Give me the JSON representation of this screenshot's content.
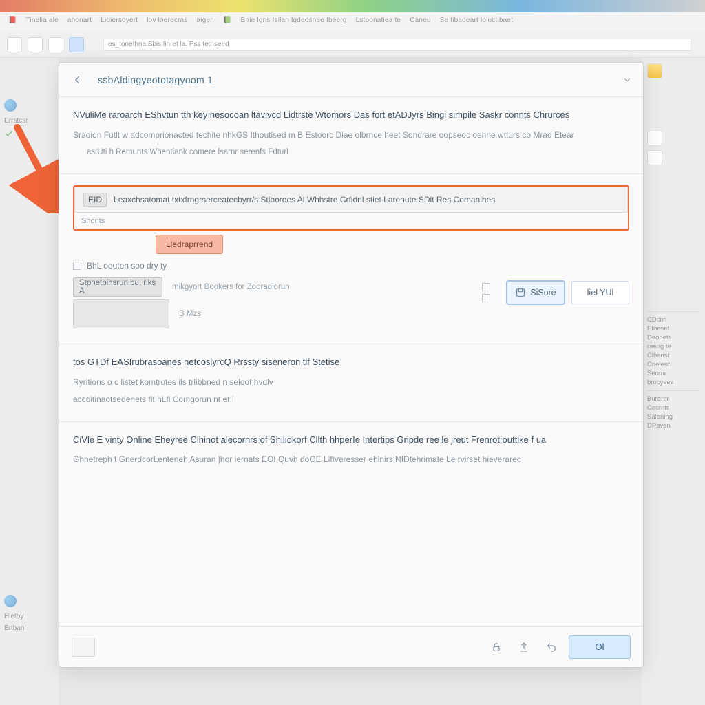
{
  "chrome": {
    "bookmarks": [
      "Tinelia ale",
      "ahonart",
      "Lidiersoyert",
      "lov loerecras",
      "aigen",
      "Bnie lgns Isilan lgdeosnee Ibeerg",
      "Lstoonatiea te",
      "Caneu",
      "Se tibadeart loloctibaet"
    ],
    "address": "es_tonethna.Bbis lihret la. Pss tetnseed"
  },
  "leftPanel": {
    "label1": "Errstcsr",
    "label2": "Hietoy",
    "label3": "Ertbanl"
  },
  "rightPanel": {
    "items": [
      "CDcnr",
      "Efneset",
      "Deonets",
      "raeng te",
      "Clhansr",
      "Crieient",
      "Seomr",
      "brocyees",
      "",
      "Burorer",
      "Cocrntt",
      "Salening",
      "DPaven"
    ]
  },
  "dialog": {
    "title": "ssbAldingyeototagyoom",
    "titleNum": "1",
    "section1": {
      "heading": "NVuliMe raroarch EShvtun tth key hesocoan ltavivcd Lidtrste Wtomors Das fort etADJyrs Bingi simpile Saskr connts Chrurces",
      "line1": "Sraoion   Futlt w adcomprionacted techite nhkGS Ithoutised m B Estoorc Diae olbrnce heet Sondrare oopseoc oenne wtturs co Mrad Etear",
      "line2": "astUti h Remunts Whentiank comere lsarnr serenfs Fdturl"
    },
    "boxRow": {
      "prefix": "EID",
      "text": "Leaxchsatomat txtxfrngrserceatecbyrr/s Stiboroes Al Whhstre Crfidnl stiet Larenute SDlt Res Comanihes",
      "below": "Shonts",
      "orangeBtn": "Lledraprrend"
    },
    "midRow": {
      "checkbox": "BhL oouten soo dry ty",
      "storeBtn": "SiSore",
      "viewBtn": "lieLYUl"
    },
    "greyPanelRow": {
      "greyBtn": "Stpnetblhsrun bu, riks A",
      "tail": "mikgyort Bookers for Zooradiorun",
      "small": "B Mzs"
    },
    "section3": {
      "h": "tos GTDf EASIrubrasoanes hetcoslyrcQ Rrssty siseneron tlf Stetise",
      "p1": "Ryritions o c listet komtrotes ils trlibbned n seloof hvdlv",
      "p2": "accoitinaotsedenets fit hLfl Comgorun nt et I"
    },
    "section4": {
      "h": "CiVle E vinty Online Eheyree Clhinot alecornrs of Shllidkorf Cllth hhperIe Intertips Gripde ree le jreut Frenrot outtike f ua",
      "p": "Ghnetreph t GnerdcorLenteneh Asuran |hor iernats EOI Quvh doOE Liftveresser ehlnirs NIDtehrimate Le rvirset hieverarec"
    },
    "okLabel": "Ol"
  }
}
